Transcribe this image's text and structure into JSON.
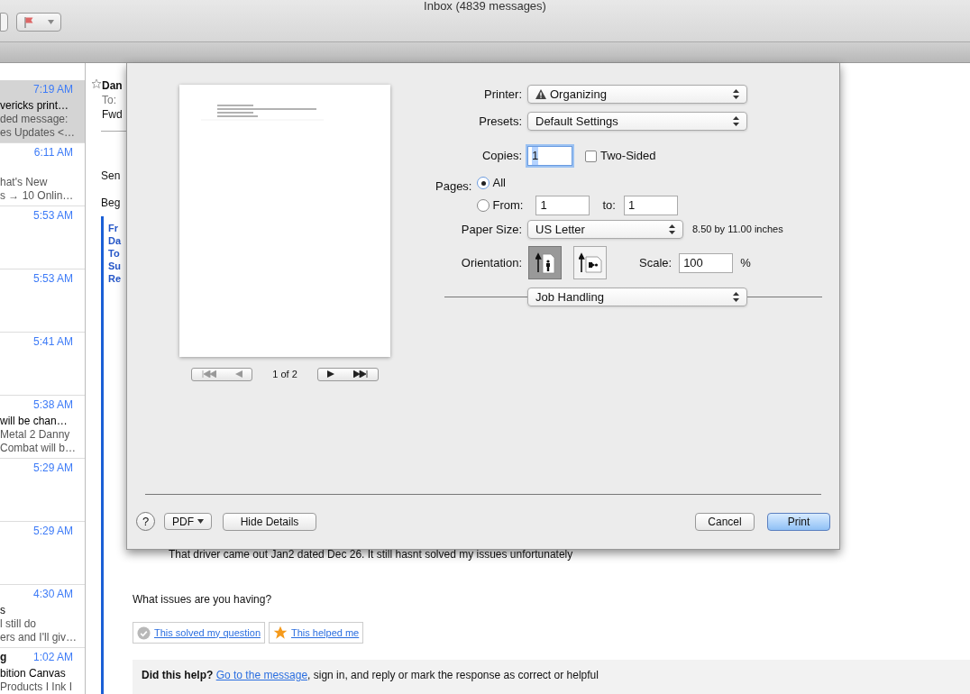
{
  "window": {
    "title": "Inbox (4839 messages)"
  },
  "message_list": [
    {
      "time": "7:19 AM",
      "selected": true,
      "subject": "vericks print…",
      "preview": [
        "ded message:",
        "es Updates <…"
      ]
    },
    {
      "time": "6:11 AM",
      "selected": false,
      "preview": [
        "hat's New",
        "s → 10 Onlin…"
      ]
    },
    {
      "time": "5:53 AM",
      "selected": false
    },
    {
      "time": "5:53 AM",
      "selected": false
    },
    {
      "time": "5:41 AM",
      "selected": false
    },
    {
      "time": "5:38 AM",
      "selected": false,
      "subject": "will be chan…",
      "preview": [
        "Metal 2 Danny",
        "Combat will b…"
      ]
    },
    {
      "time": "5:29 AM",
      "selected": false
    },
    {
      "time": "5:29 AM",
      "selected": false
    },
    {
      "time": "4:30 AM",
      "selected": false,
      "subject": "s",
      "preview": [
        "l still do",
        "ers and I'll giv…"
      ]
    },
    {
      "time": "1:02 AM",
      "selected": false,
      "sender": "g",
      "subject": "bition Canvas",
      "preview": [
        "Products I Ink I"
      ]
    }
  ],
  "message": {
    "starred": false,
    "sender": "Dan",
    "to_label": "To:",
    "subject": "Fwd",
    "body": [
      "Sen",
      "Beg"
    ],
    "quote_header": [
      "Fr",
      "Da",
      "To",
      "Su",
      "Re"
    ],
    "reply": "That driver came out Jan2 dated Dec 26. It still hasnt solved my issues unfortunately",
    "question": "What issues are you having?",
    "feedback_buttons": [
      {
        "kind": "solved",
        "label": "This solved my question"
      },
      {
        "kind": "helped",
        "label": "This helped me"
      }
    ],
    "help_box": {
      "lead": "Did this help?",
      "link": "Go to the message",
      "rest": ", sign in, and reply or mark the response as correct or helpful"
    }
  },
  "print_dialog": {
    "page_indicator": "1 of 2",
    "printer": {
      "label": "Printer:",
      "value": "Organizing",
      "warning": true
    },
    "presets": {
      "label": "Presets:",
      "value": "Default Settings"
    },
    "copies": {
      "label": "Copies:",
      "value": "1",
      "focused": true
    },
    "two_sided": {
      "label": "Two-Sided",
      "checked": false
    },
    "pages": {
      "label": "Pages:",
      "options": [
        {
          "label": "All",
          "selected": true
        },
        {
          "label": "From:",
          "selected": false
        }
      ],
      "from": "1",
      "to_label": "to:",
      "to": "1"
    },
    "paper_size": {
      "label": "Paper Size:",
      "value": "US Letter",
      "dimensions": "8.50 by 11.00 inches"
    },
    "orientation": {
      "label": "Orientation:",
      "options": [
        {
          "kind": "portrait",
          "selected": true
        },
        {
          "kind": "landscape",
          "selected": false
        }
      ]
    },
    "scale": {
      "label": "Scale:",
      "value": "100",
      "unit": "%"
    },
    "section": "Job Handling",
    "help": "?",
    "pdf": "PDF",
    "details": "Hide Details",
    "buttons": [
      {
        "label": "Cancel",
        "default": false
      },
      {
        "label": "Print",
        "default": true
      }
    ]
  }
}
